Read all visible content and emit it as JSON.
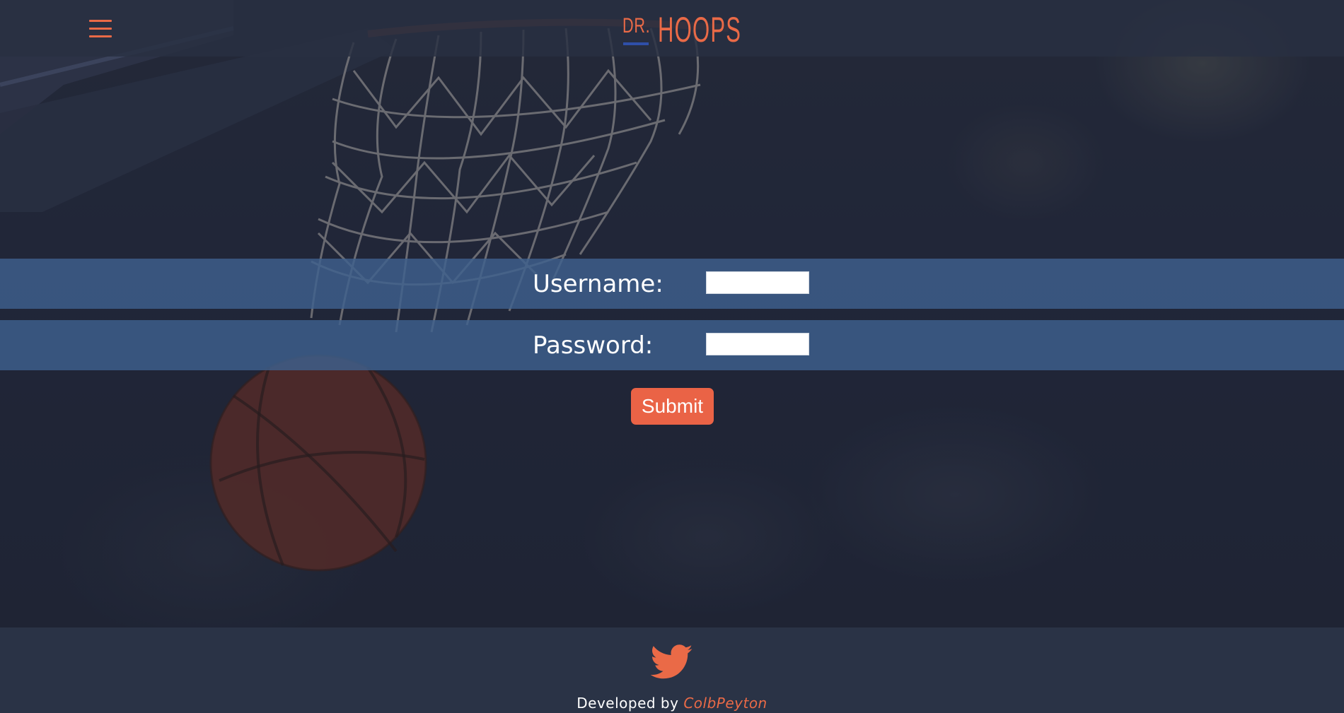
{
  "header": {
    "logo_prefix": "DR.",
    "logo_name": "HOOPS",
    "menu_icon": "hamburger-menu-icon"
  },
  "login_form": {
    "username_label": "Username:",
    "username_value": "",
    "password_label": "Password:",
    "password_value": "",
    "submit_label": "Submit"
  },
  "footer": {
    "social_icon": "twitter-icon",
    "credit_prefix": "Developed by",
    "credit_author": "ColbPeyton"
  },
  "colors": {
    "accent": "#ea6a47",
    "header_bg": "#283042",
    "form_row_bg": "#3e608e",
    "footer_bg": "#2a3346",
    "logo_underline": "#2f4fa8"
  }
}
